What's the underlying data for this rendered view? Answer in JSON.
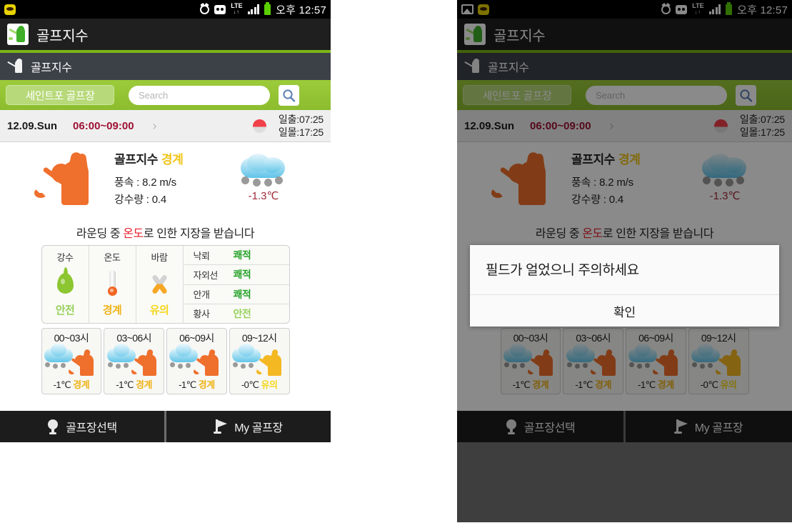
{
  "statusbar": {
    "clock": "오후 12:57",
    "icons_left_panel": [
      "kakao-icon"
    ],
    "icons_right_panel": [
      "gallery-icon",
      "kakao-icon"
    ],
    "icons_right_group": [
      "alarm-icon",
      "sync-icon",
      "lte-icon",
      "signal-icon",
      "battery-icon"
    ],
    "lte_label": "LTE",
    "lte_sub": "↓↑"
  },
  "appbar": {
    "title": "골프지수"
  },
  "subbar": {
    "title": "골프지수"
  },
  "search": {
    "course_button": "세인트포 골프장",
    "placeholder": "Search",
    "value": "",
    "search_icon": "magnifier-icon"
  },
  "daterow": {
    "date": "12.09.Sun",
    "timerange": "06:00~09:00",
    "chevron": "›",
    "sun_icon": "sun-icon",
    "sunrise": "일출:07:25",
    "sunset": "일몰:17:25"
  },
  "summary": {
    "golfer_icon": "golfer-icon",
    "index_label": "골프지수",
    "index_level": "경계",
    "wind": "풍속 : 8.2 m/s",
    "rain": "강수량 : 0.4",
    "weather_icon": "snow-cloud-icon",
    "temperature": "-1.3℃",
    "advice_before": "라운딩 중 ",
    "advice_highlight": "온도",
    "advice_after": "로 인한 지장을 받습니다"
  },
  "indicators": {
    "columns": [
      {
        "label": "강수",
        "icon": "water-drop-icon",
        "value": "안전",
        "color": "#96d15a"
      },
      {
        "label": "온도",
        "icon": "thermometer-icon",
        "value": "경계",
        "color": "#f0b41b"
      },
      {
        "label": "바람",
        "icon": "wind-fan-icon",
        "value": "유의",
        "color": "#f5d71b"
      }
    ],
    "rows": [
      {
        "key": "낙뢰",
        "value": "쾌적",
        "color": "#26a32a"
      },
      {
        "key": "자외선",
        "value": "쾌적",
        "color": "#26a32a"
      },
      {
        "key": "안개",
        "value": "쾌적",
        "color": "#26a32a"
      },
      {
        "key": "황사",
        "value": "안전",
        "color": "#96d15a"
      }
    ]
  },
  "hourly": [
    {
      "range": "00~03시",
      "temp": "-1℃",
      "status": "경계",
      "color": "#f0b41b",
      "figure": "#ef6f2c"
    },
    {
      "range": "03~06시",
      "temp": "-1℃",
      "status": "경계",
      "color": "#f0b41b",
      "figure": "#ef6f2c"
    },
    {
      "range": "06~09시",
      "temp": "-1℃",
      "status": "경계",
      "color": "#f0b41b",
      "figure": "#ef6f2c"
    },
    {
      "range": "09~12시",
      "temp": "-0℃",
      "status": "유의",
      "color": "#f5d71b",
      "figure": "#f4b822"
    }
  ],
  "bottomnav": [
    {
      "label": "골프장선택",
      "icon": "golf-tee-icon"
    },
    {
      "label": "My 골프장",
      "icon": "golf-flag-icon"
    }
  ],
  "dialog": {
    "message": "필드가 얼었으니 주의하세요",
    "confirm": "확인"
  },
  "colors": {
    "brand_green": "#8cbd2e",
    "appbar_dark": "#1f1f1f",
    "subbar_dark": "#3c4148",
    "accent_red": "#9e1133",
    "warn_yellow": "#f0c419",
    "figure_orange": "#ef6f2c"
  }
}
